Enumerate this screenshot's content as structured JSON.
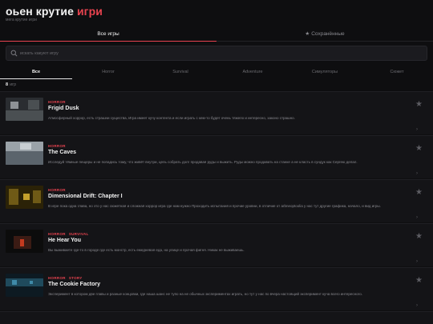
{
  "header": {
    "title_main": "оьен крутие ",
    "title_accent": "игри",
    "subtitle": "мега крутие игри"
  },
  "main_tabs": [
    {
      "label": "Все игры",
      "active": true
    },
    {
      "label": "Сохранённые",
      "icon": "star-icon",
      "active": false
    }
  ],
  "search": {
    "placeholder": "искать какуют игру",
    "value": ""
  },
  "categories": [
    {
      "label": "Все",
      "active": true
    },
    {
      "label": "Horror",
      "active": false
    },
    {
      "label": "Survival",
      "active": false
    },
    {
      "label": "Adventure",
      "active": false
    },
    {
      "label": "Симуляторы",
      "active": false
    },
    {
      "label": "Сюжет",
      "active": false
    }
  ],
  "count": {
    "number": "8",
    "suffix": "игр"
  },
  "games": [
    {
      "tags": [
        "HORROR"
      ],
      "name": "Frigid Dusk",
      "description": "Атмосферный хоррор, есть страшни существа, Игра имеет кучу контента и если играть с кем-то будет очень тяжело и интересно, законо страшно.",
      "thumb_colors": [
        "#2a2d31",
        "#4a4f52",
        "#8e9296"
      ]
    },
    {
      "tags": [
        "HORROR"
      ],
      "name": "The Caves",
      "description": "Исследуй тёмные пещеры и не попадись тому, что живёт внутри, цель собрать долг продавая руды и выжить. Руды можно продавать на станке а не класть в сундук как Сергею делал.",
      "thumb_colors": [
        "#5b646c",
        "#9aa2a8",
        "#c9cfd3"
      ]
    },
    {
      "tags": [
        "HORROR"
      ],
      "name": "Dimensional Drift: Chapter I",
      "description": "В игре пока одна глава, но это у нас сюжетная и сложная хоррор игра где нам нужно Проходить испытания и прочие уровни, в отличие от arbneoptoolia у нас тут другие графика, начало, и вид игры.",
      "thumb_colors": [
        "#2b2207",
        "#6f5a16",
        "#c4a02c"
      ]
    },
    {
      "tags": [
        "HORROR",
        "SURVIVAL"
      ],
      "name": "He Hear You",
      "description": "Вы выживаете где-то в городе где есть монстр, есть ежедневая еда, на улице и прочая фигня. Никак не выживаешь.",
      "thumb_colors": [
        "#0c0c0c",
        "#3b1b14",
        "#c33a1f"
      ]
    },
    {
      "tags": [
        "HORROR",
        "STORY"
      ],
      "name": "The Cookie Factory",
      "description": "Эксперимент в котором две главы и разные концовки, где наша шанс не тупо на не обычных экспериментах играть, но тут у нас по вчера настоящий эксперимент куча всего интересного.",
      "thumb_colors": [
        "#0d1a22",
        "#1f4a5c",
        "#3f8aa8"
      ]
    }
  ],
  "colors": {
    "accent": "#e8434f",
    "background": "#0e0e10",
    "card": "#141417"
  }
}
